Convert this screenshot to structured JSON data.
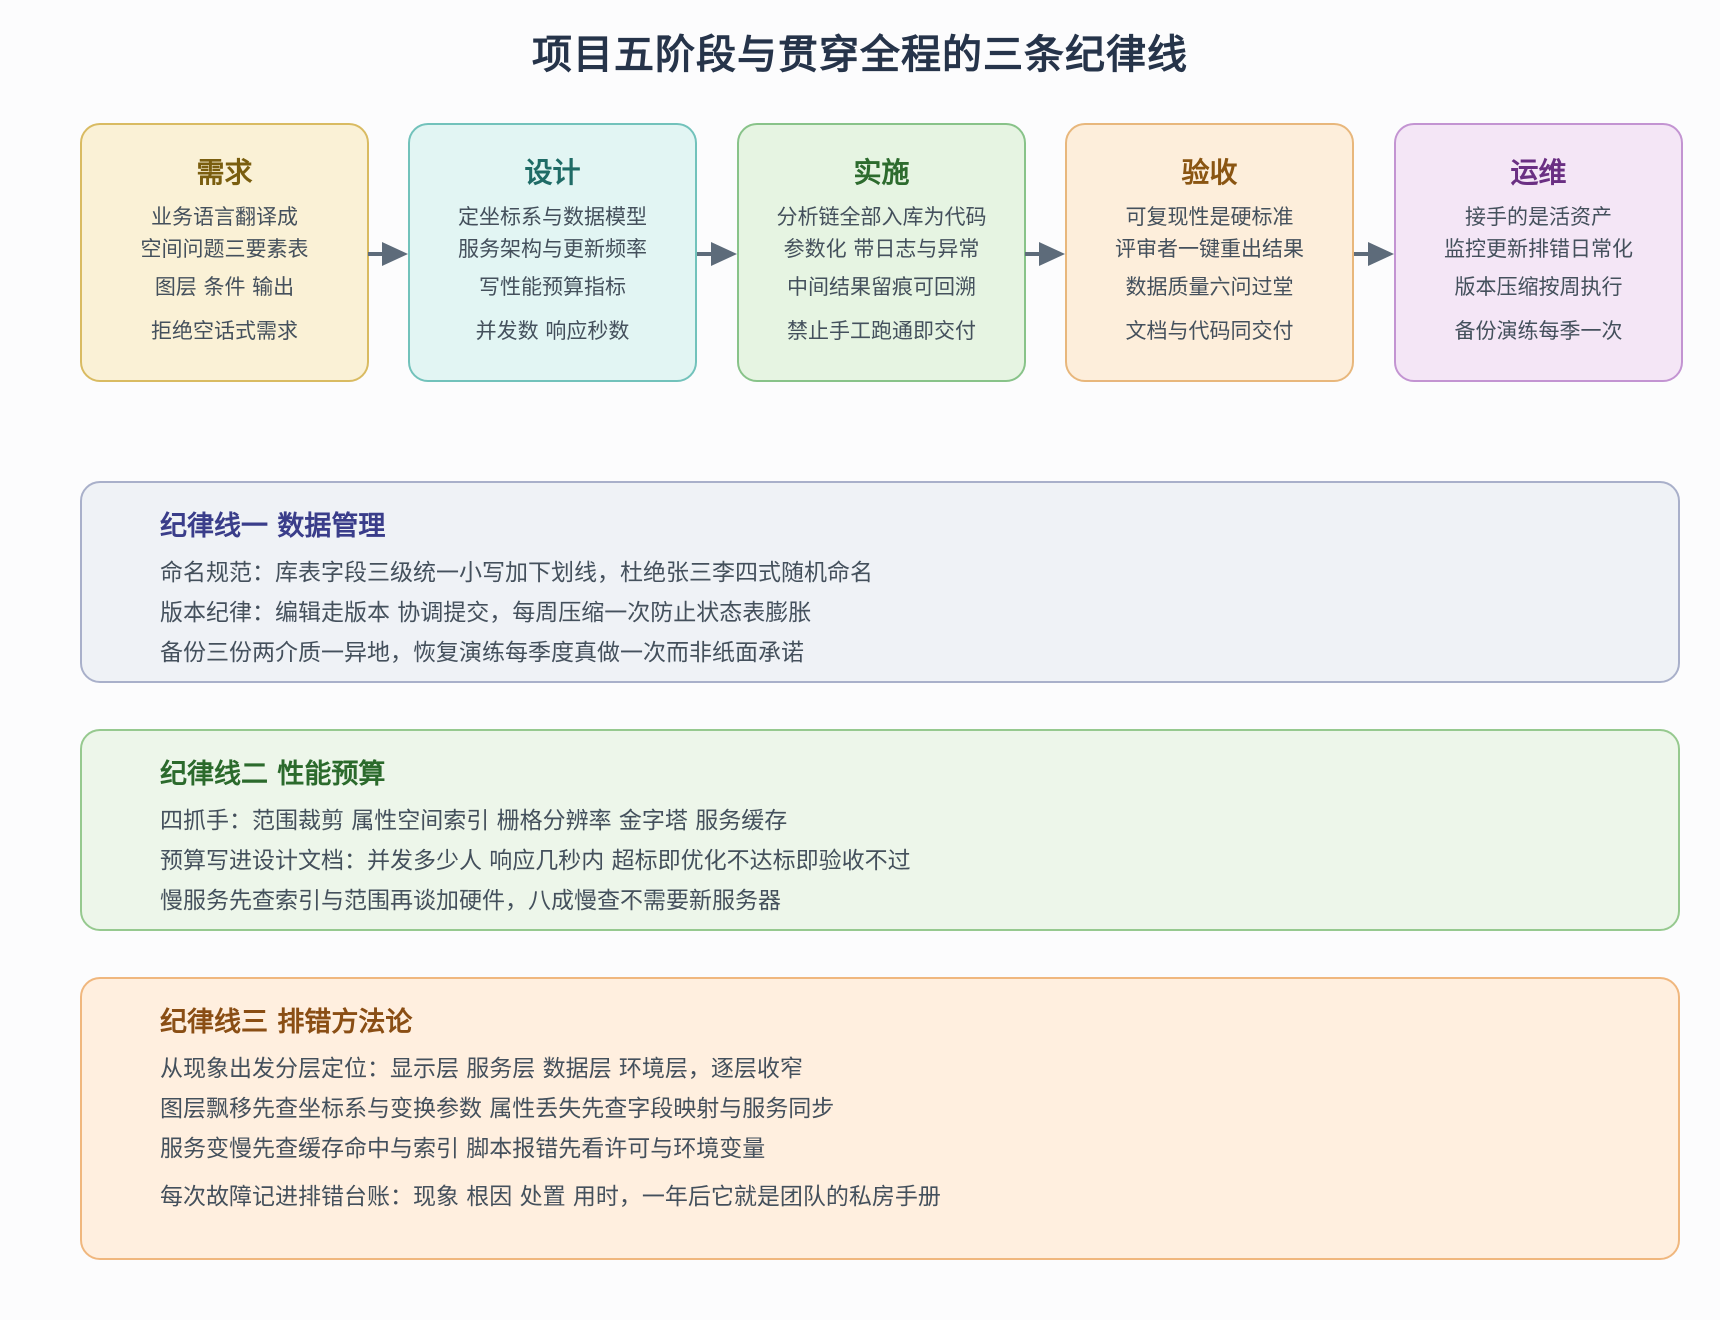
{
  "title": "项目五阶段与贯穿全程的三条纪律线",
  "colors": {
    "arrow": "#5d6b7a"
  },
  "stages": [
    {
      "title": "需求",
      "lines": [
        "业务语言翻译成",
        "空间问题三要素表",
        "图层 条件 输出",
        "拒绝空话式需求"
      ],
      "bg": "#faf1d6",
      "border": "#d9bb62",
      "title_color": "#7a5e0f"
    },
    {
      "title": "设计",
      "lines": [
        "定坐标系与数据模型",
        "服务架构与更新频率",
        "写性能预算指标",
        "并发数 响应秒数"
      ],
      "bg": "#e2f5f3",
      "border": "#72c2bb",
      "title_color": "#1f6b66"
    },
    {
      "title": "实施",
      "lines": [
        "分析链全部入库为代码",
        "参数化 带日志与异常",
        "中间结果留痕可回溯",
        "禁止手工跑通即交付"
      ],
      "bg": "#e6f4e2",
      "border": "#88c389",
      "title_color": "#2d6b2e"
    },
    {
      "title": "验收",
      "lines": [
        "可复现性是硬标准",
        "评审者一键重出结果",
        "数据质量六问过堂",
        "文档与代码同交付"
      ],
      "bg": "#fdeedb",
      "border": "#e8b77c",
      "title_color": "#8a5512"
    },
    {
      "title": "运维",
      "lines": [
        "接手的是活资产",
        "监控更新排错日常化",
        "版本压缩按周执行",
        "备份演练每季一次"
      ],
      "bg": "#f4e6f6",
      "border": "#c394d2",
      "title_color": "#6a2f83"
    }
  ],
  "lines": [
    {
      "title": "纪律线一 数据管理",
      "items": [
        "命名规范：库表字段三级统一小写加下划线，杜绝张三李四式随机命名",
        "版本纪律：编辑走版本 协调提交，每周压缩一次防止状态表膨胀",
        "备份三份两介质一异地，恢复演练每季度真做一次而非纸面承诺"
      ],
      "bg": "#eff2f6",
      "border": "#a9b0ca",
      "title_color": "#3a3d8a"
    },
    {
      "title": "纪律线二 性能预算",
      "items": [
        "四抓手：范围裁剪 属性空间索引 栅格分辨率 金字塔 服务缓存",
        "预算写进设计文档：并发多少人 响应几秒内 超标即优化不达标即验收不过",
        "慢服务先查索引与范围再谈加硬件，八成慢查不需要新服务器"
      ],
      "bg": "#edf6ea",
      "border": "#96c98f",
      "title_color": "#2b6a2c"
    },
    {
      "title": "纪律线三 排错方法论",
      "items": [
        "从现象出发分层定位：显示层 服务层 数据层 环境层，逐层收窄",
        "图层飘移先查坐标系与变换参数 属性丢失先查字段映射与服务同步",
        "服务变慢先查缓存命中与索引 脚本报错先看许可与环境变量",
        "每次故障记进排错台账：现象 根因 处置 用时，一年后它就是团队的私房手册"
      ],
      "bg": "#ffefdf",
      "border": "#f0b77e",
      "title_color": "#8a4e14"
    }
  ]
}
